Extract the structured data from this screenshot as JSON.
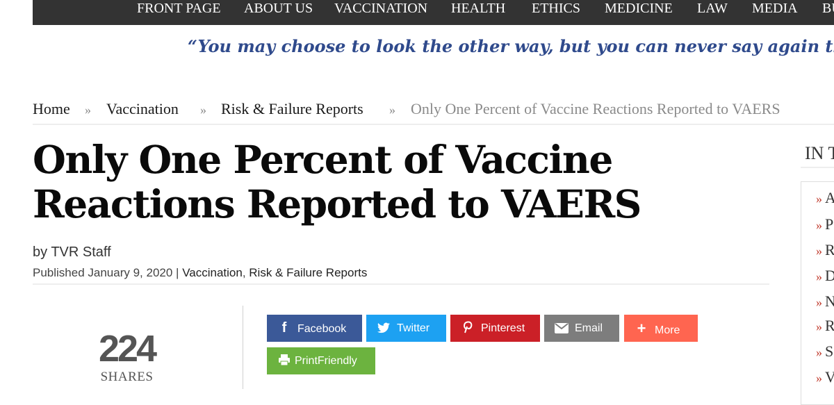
{
  "nav": {
    "items": [
      "FRONT PAGE",
      "ABOUT US",
      "VACCINATION",
      "HEALTH",
      "ETHICS",
      "MEDICINE",
      "LAW",
      "MEDIA",
      "BU"
    ]
  },
  "banner": {
    "quote": "“You may choose to look the other way, but you can never say again that y"
  },
  "breadcrumb": {
    "home": "Home",
    "sep": "»",
    "vaccination": "Vaccination",
    "category": "Risk & Failure Reports",
    "current": "Only One Percent of Vaccine Reactions Reported to VAERS"
  },
  "article": {
    "title_line1": "Only One Percent of Vaccine",
    "title_line2": "Reactions Reported to VAERS",
    "byline": "by TVR Staff",
    "published_prefix": "Published January 9, 2020 | ",
    "cat1": "Vaccination",
    "comma": ", ",
    "cat2": "Risk & Failure Reports"
  },
  "share": {
    "count": "224",
    "count_label": "SHARES",
    "buttons": {
      "facebook": "Facebook",
      "twitter": "Twitter",
      "pinterest": "Pinterest",
      "email": "Email",
      "more": "More",
      "printfriendly": "PrintFriendly"
    },
    "colors": {
      "facebook": "#3b5998",
      "twitter": "#1da1f2",
      "pinterest": "#cb2027",
      "email": "#7d7d7d",
      "more": "#ff6550",
      "printfriendly": "#6cb33f"
    }
  },
  "sidebar": {
    "heading": "IN T",
    "items": [
      "A",
      "P",
      "R",
      "D",
      "N",
      "R",
      "S",
      "V"
    ],
    "marker": "»"
  }
}
